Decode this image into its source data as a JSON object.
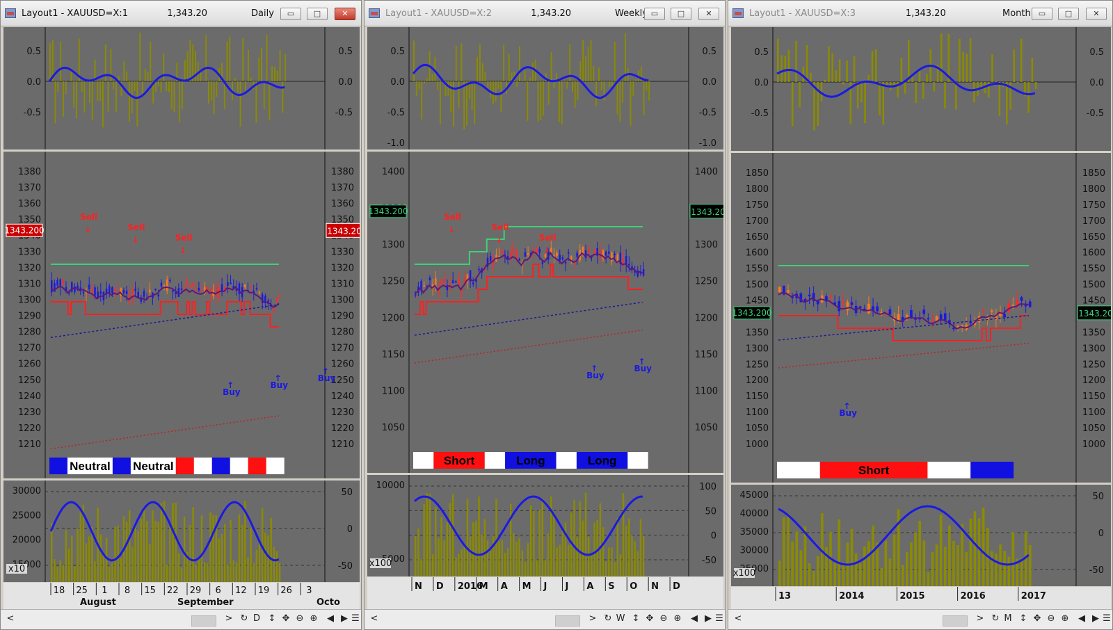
{
  "windows": [
    {
      "id": "daily",
      "title": "Layout1 - XAUUSD=X:1",
      "price": "1,343.20",
      "timeframe": "Daily",
      "active": true,
      "osc_ticks": [
        "0.5",
        "0.0",
        "-0.5"
      ],
      "price_ticks": [
        "1380",
        "1370",
        "1360",
        "1350",
        "1340",
        "1330",
        "1320",
        "1310",
        "1300",
        "1290",
        "1280",
        "1270",
        "1260",
        "1250",
        "1240",
        "1230",
        "1220",
        "1210"
      ],
      "last_price_left": "1343.200",
      "last_price_right": "1343.20",
      "signals": [
        {
          "text": "Sell",
          "dir": "down"
        },
        {
          "text": "Sell",
          "dir": "down"
        },
        {
          "text": "Sell",
          "dir": "down"
        },
        {
          "text": "Buy",
          "dir": "up"
        },
        {
          "text": "Buy",
          "dir": "up"
        },
        {
          "text": "Buy",
          "dir": "up"
        }
      ],
      "bands": [
        {
          "label": "",
          "color": "#1010e0"
        },
        {
          "label": "Neutral",
          "color": "#ffffff"
        },
        {
          "label": "",
          "color": "#1010e0"
        },
        {
          "label": "Neutral",
          "color": "#ffffff"
        },
        {
          "label": "",
          "color": "#ff1010"
        },
        {
          "label": "",
          "color": "#ffffff"
        },
        {
          "label": "",
          "color": "#1010e0"
        },
        {
          "label": "",
          "color": "#ffffff"
        },
        {
          "label": "",
          "color": "#ff1010"
        },
        {
          "label": "",
          "color": "#ffffff"
        }
      ],
      "vol_ticks_left": [
        "30000",
        "25000",
        "20000",
        "15000"
      ],
      "vol_mult": "x10",
      "vol_ticks_right": [
        "50",
        "0",
        "-50"
      ],
      "date_top": [
        "18",
        "25",
        "1",
        "8",
        "15",
        "22",
        "29",
        "6",
        "12",
        "19",
        "26",
        "3"
      ],
      "date_bottom": [
        "August",
        "September",
        "Octo"
      ],
      "status_letter": "D"
    },
    {
      "id": "weekly",
      "title": "Layout1 - XAUUSD=X:2",
      "price": "1,343.20",
      "timeframe": "Weekly",
      "active": false,
      "osc_ticks": [
        "0.5",
        "0.0",
        "-0.5",
        "-1.0"
      ],
      "price_ticks": [
        "1400",
        "1350",
        "1300",
        "1250",
        "1200",
        "1150",
        "1100",
        "1050"
      ],
      "last_price_left": "1343.200",
      "last_price_right": "1343.20",
      "signals": [
        {
          "text": "Sell",
          "dir": "down"
        },
        {
          "text": "Sell",
          "dir": "down"
        },
        {
          "text": "Sell",
          "dir": "down"
        },
        {
          "text": "Buy",
          "dir": "up"
        },
        {
          "text": "Buy",
          "dir": "up"
        }
      ],
      "bands": [
        {
          "label": "",
          "color": "#ffffff"
        },
        {
          "label": "Short",
          "color": "#ff1010"
        },
        {
          "label": "",
          "color": "#ffffff"
        },
        {
          "label": "Long",
          "color": "#1010e0"
        },
        {
          "label": "",
          "color": "#ffffff"
        },
        {
          "label": "Long",
          "color": "#1010e0"
        },
        {
          "label": "",
          "color": "#ffffff"
        }
      ],
      "vol_ticks_left": [
        "10000",
        "5000"
      ],
      "vol_mult": "x100",
      "vol_ticks_right": [
        "100",
        "50",
        "0",
        "-50"
      ],
      "date_labels": [
        "N",
        "D",
        "2016",
        "M",
        "A",
        "M",
        "J",
        "J",
        "A",
        "S",
        "O",
        "N",
        "D"
      ],
      "status_letter": "W"
    },
    {
      "id": "monthly",
      "title": "Layout1 - XAUUSD=X:3",
      "price": "1,343.20",
      "timeframe": "Monthly",
      "active": false,
      "osc_ticks": [
        "0.5",
        "0.0",
        "-0.5"
      ],
      "price_ticks": [
        "1850",
        "1800",
        "1750",
        "1700",
        "1650",
        "1600",
        "1550",
        "1500",
        "1450",
        "1400",
        "1350",
        "1300",
        "1250",
        "1200",
        "1150",
        "1100",
        "1050",
        "1000"
      ],
      "last_price_left": "1343.200",
      "last_price_right": "1343.20",
      "signals": [
        {
          "text": "Buy",
          "dir": "up"
        }
      ],
      "bands": [
        {
          "label": "",
          "color": "#ffffff"
        },
        {
          "label": "Short",
          "color": "#ff1010"
        },
        {
          "label": "",
          "color": "#ffffff"
        },
        {
          "label": "",
          "color": "#1010e0"
        }
      ],
      "vol_ticks_left": [
        "45000",
        "40000",
        "35000",
        "30000",
        "25000"
      ],
      "vol_mult": "x100",
      "vol_ticks_right": [
        "50",
        "0",
        "-50"
      ],
      "date_labels": [
        "13",
        "2014",
        "2015",
        "2016",
        "2017"
      ],
      "status_letter": "M"
    }
  ],
  "colors": {
    "chart_bg": "#6b6b6b",
    "osc_bar": "#8b8b00",
    "osc_line": "#1a1ae0",
    "upper_channel": "#3cd17a",
    "lower_channel": "#ff2020",
    "bull_candle": "#1a1ae0",
    "bear_candle": "#ff7a1a"
  }
}
